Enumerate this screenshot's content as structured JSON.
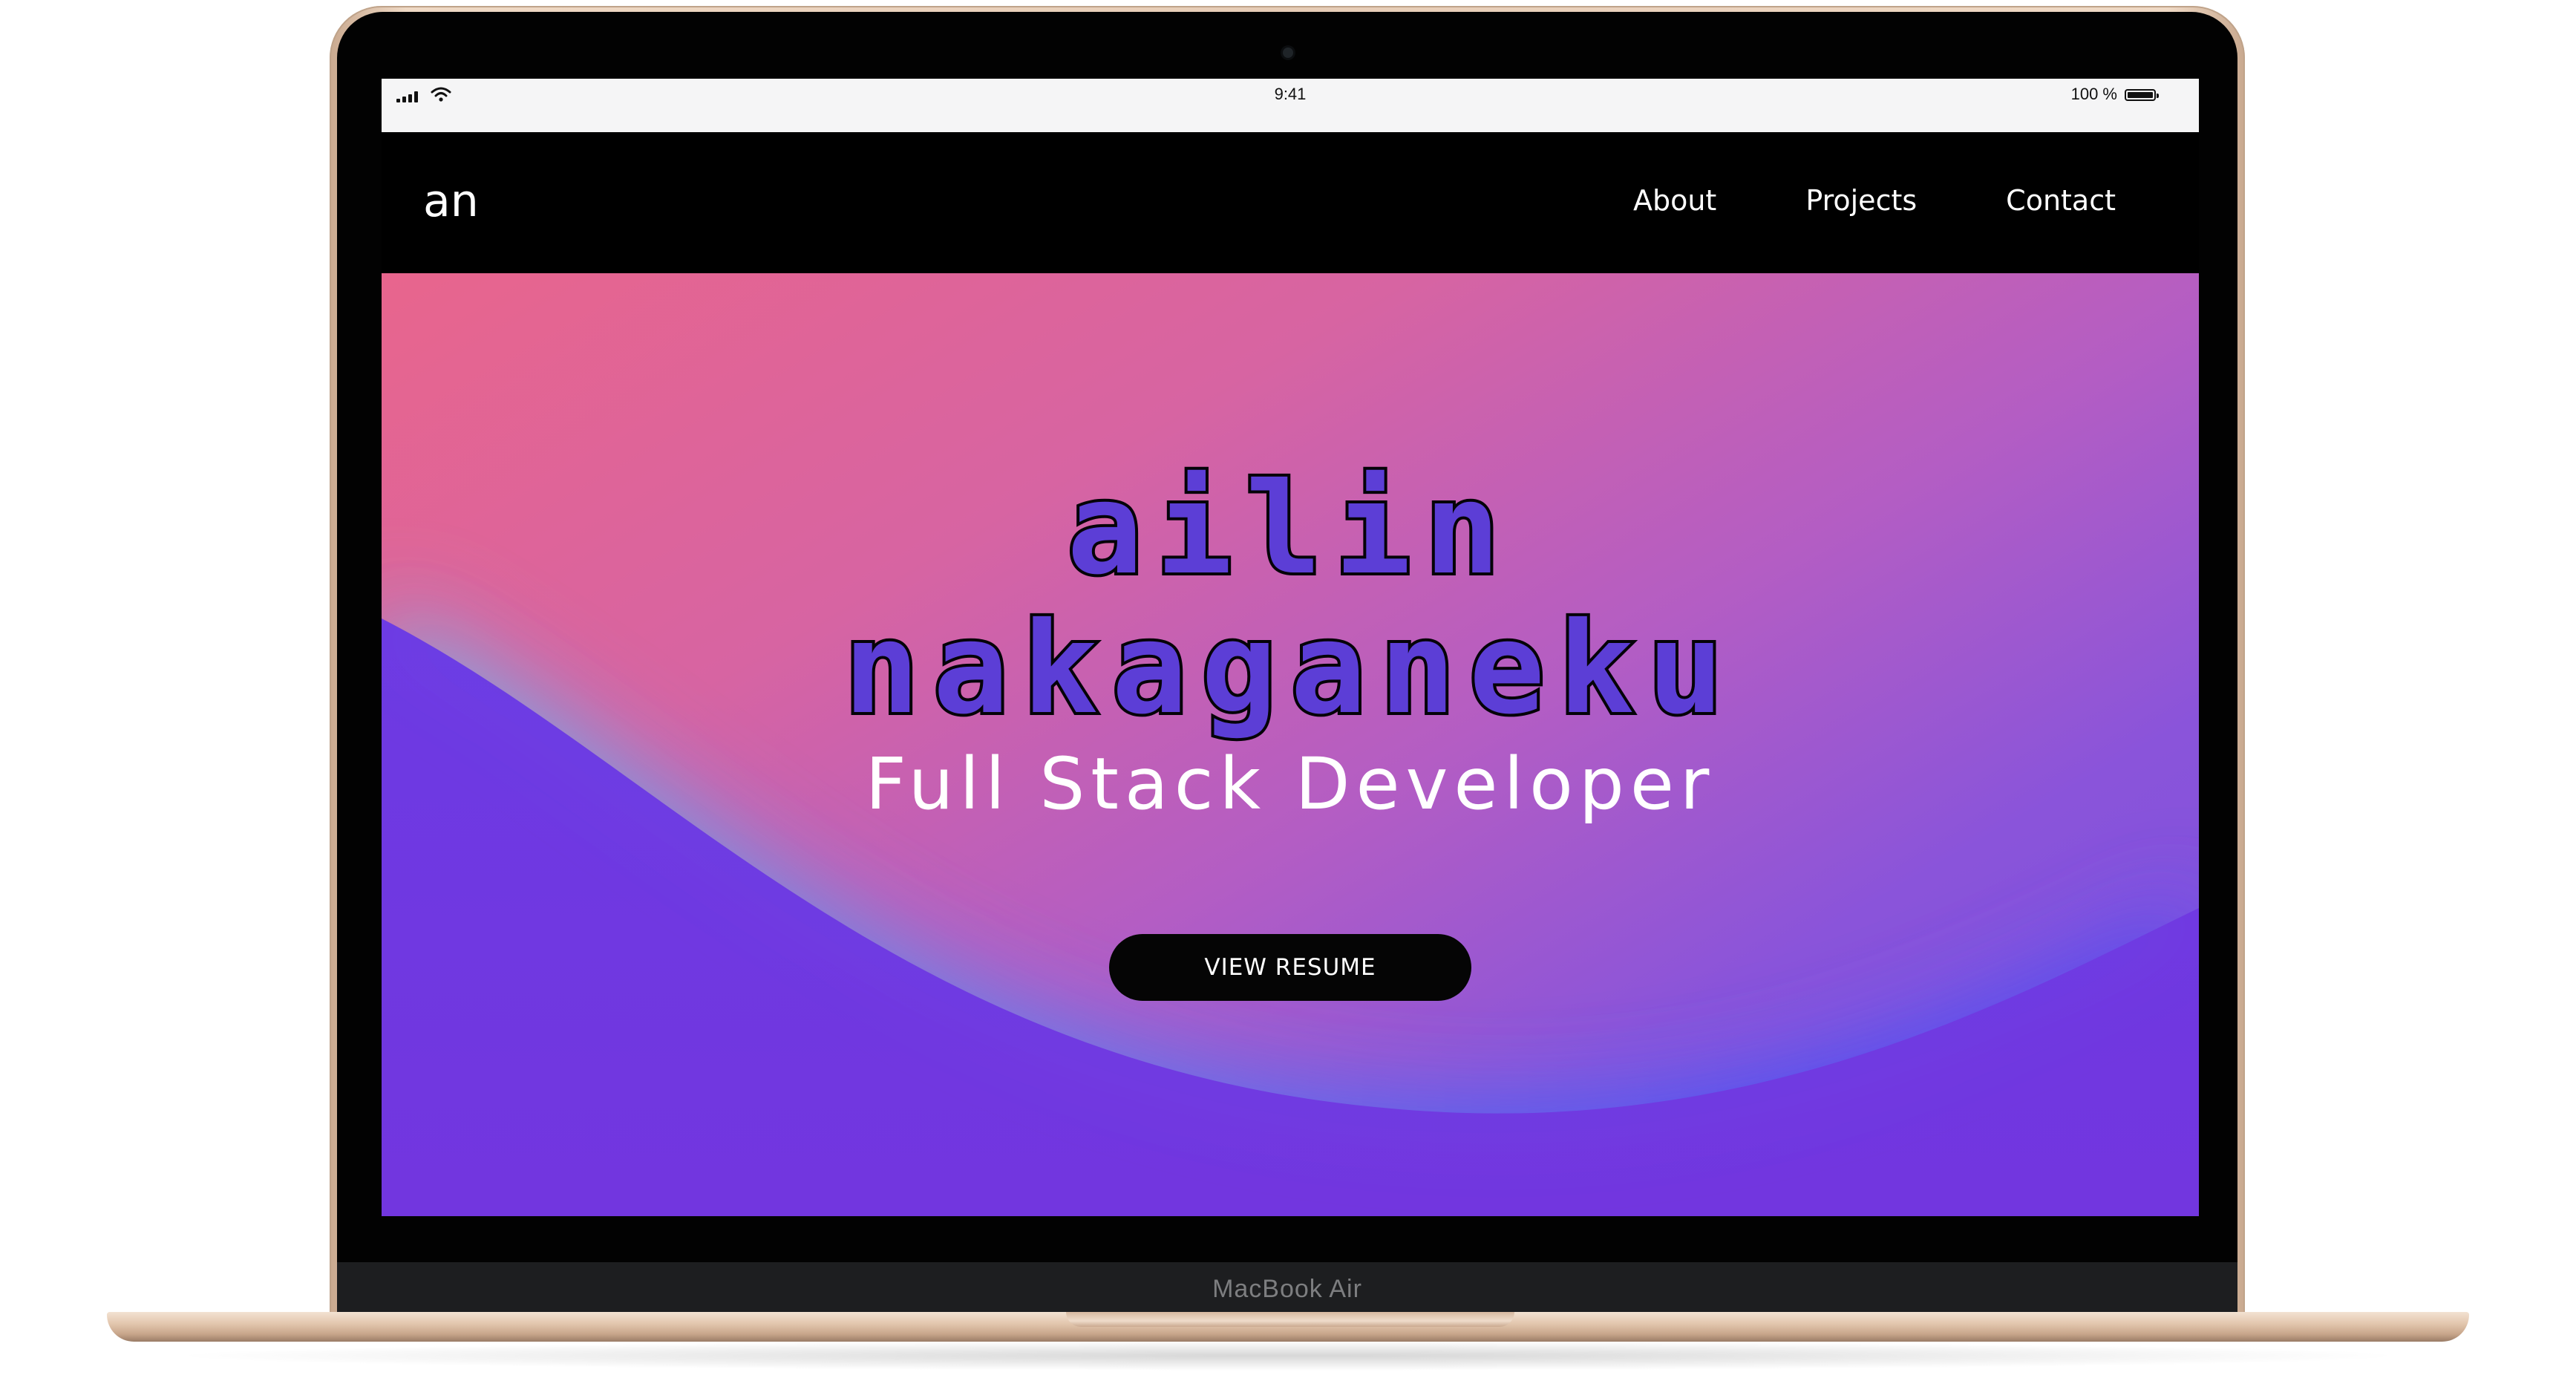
{
  "status_bar": {
    "time": "9:41",
    "battery_percent": "100 %",
    "signal_icon": "signal-bars-icon",
    "wifi_icon": "wifi-icon",
    "battery_icon": "battery-icon"
  },
  "navbar": {
    "logo": "an",
    "links": [
      "About",
      "Projects",
      "Contact"
    ]
  },
  "hero": {
    "name_line1": "ailin",
    "name_line2": "nakaganeku",
    "subtitle": "Full Stack Developer",
    "cta_label": "VIEW RESUME"
  },
  "device": {
    "model_label": "MacBook Air"
  },
  "colors": {
    "hero_top": "#e8658d",
    "hero_purple": "#6f3be4",
    "wave_blue": "#4c55f2",
    "button_bg": "#050505",
    "title_fill": "#5c3ed6"
  }
}
